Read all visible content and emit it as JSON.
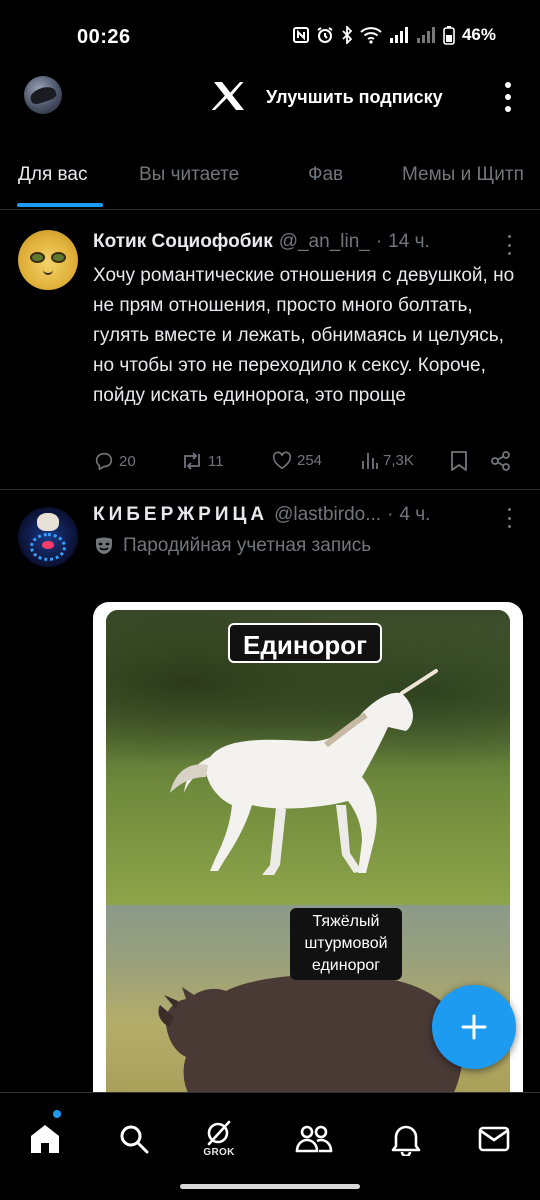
{
  "status_bar": {
    "time": "00:26",
    "battery": "46%"
  },
  "header": {
    "upgrade_label": "Улучшить подписку"
  },
  "tabs": [
    {
      "label": "Для вас",
      "active": true
    },
    {
      "label": "Вы читаете",
      "active": false
    },
    {
      "label": "Фав",
      "active": false
    },
    {
      "label": "Мемы и Щитп",
      "active": false
    }
  ],
  "tweets": [
    {
      "name": "Котик Социофобик",
      "handle": "@_an_lin_",
      "dot": "·",
      "time": "14 ч.",
      "text": "Хочу романтические отношения с девушкой, но не прям отношения, просто много болтать, гулять вместе и лежать, обнимаясь и целуясь, но чтобы это не переходило к сексу. Короче, пойду искать единорога, это проще",
      "replies": "20",
      "reposts": "11",
      "likes": "254",
      "views": "7,3K"
    },
    {
      "name": "КИБЕРЖРИЦА",
      "handle": "@lastbirdo...",
      "dot": "·",
      "time": "4 ч.",
      "parody_label": "Пародийная учетная запись",
      "media": {
        "top_label": "Единорог",
        "bottom_label_line1": "Тяжёлый",
        "bottom_label_line2": "штурмовой",
        "bottom_label_line3": "единорог"
      }
    }
  ],
  "nav": {
    "grok_label": "GROK"
  },
  "colors": {
    "accent": "#1d9bf0",
    "muted": "#71767b",
    "divider": "#2f3336"
  }
}
